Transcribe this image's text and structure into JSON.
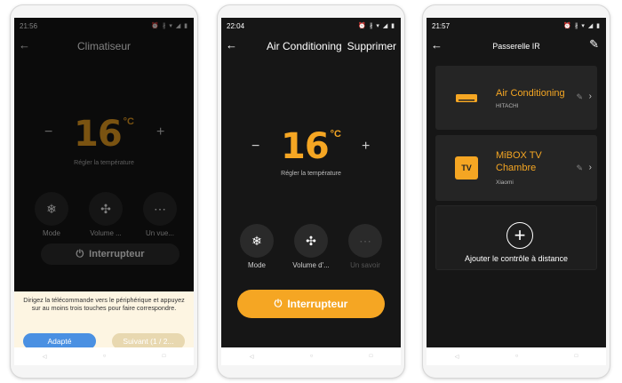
{
  "phone1": {
    "status": {
      "time": "21:56",
      "icons": "⏰ ∦ ▾ ◢ ▮"
    },
    "title": "Climatiseur",
    "temp": {
      "value": "16",
      "unit": "°C",
      "label": "Régler la température",
      "minus": "−",
      "plus": "+"
    },
    "modes": [
      {
        "label": "Mode",
        "icon": "❄"
      },
      {
        "label": "Volume ...",
        "icon": "✣"
      },
      {
        "label": "Un vue...",
        "icon": "⋯"
      }
    ],
    "power_label": "Interrupteur",
    "tip": {
      "text": "Dirigez la télécommande vers le périphérique et appuyez sur au moins trois touches pour faire correspondre.",
      "adapted": "Adapté",
      "next": "Suivant (1 / 2..."
    }
  },
  "phone2": {
    "status": {
      "time": "22:04",
      "icons": "⏰ ∦ ▾ ◢ ▮"
    },
    "title": "Air Conditioning",
    "action": "Supprimer",
    "temp": {
      "value": "16",
      "unit": "°C",
      "label": "Régler la température",
      "minus": "−",
      "plus": "+"
    },
    "modes": [
      {
        "label": "Mode",
        "icon": "❄"
      },
      {
        "label": "Volume d'...",
        "icon": "✣"
      },
      {
        "label": "Un savoir",
        "icon": "⋯"
      }
    ],
    "power_label": "Interrupteur"
  },
  "phone3": {
    "status": {
      "time": "21:57",
      "icons": "⏰ ∦ ▾ ◢ ▮"
    },
    "title": "Passerelle IR",
    "devices": [
      {
        "name": "Air Conditioning",
        "brand": "HITACHI",
        "icon": "ac-unit-icon"
      },
      {
        "name": "MiBOX TV Chambre",
        "brand": "Xiaomi",
        "icon": "tv-icon",
        "icon_text": "TV"
      }
    ],
    "add_label": "Ajouter le contrôle à distance"
  },
  "colors": {
    "accent": "#f5a623",
    "background": "#161616",
    "card": "#252525",
    "tip_button": "#4a90e2"
  }
}
